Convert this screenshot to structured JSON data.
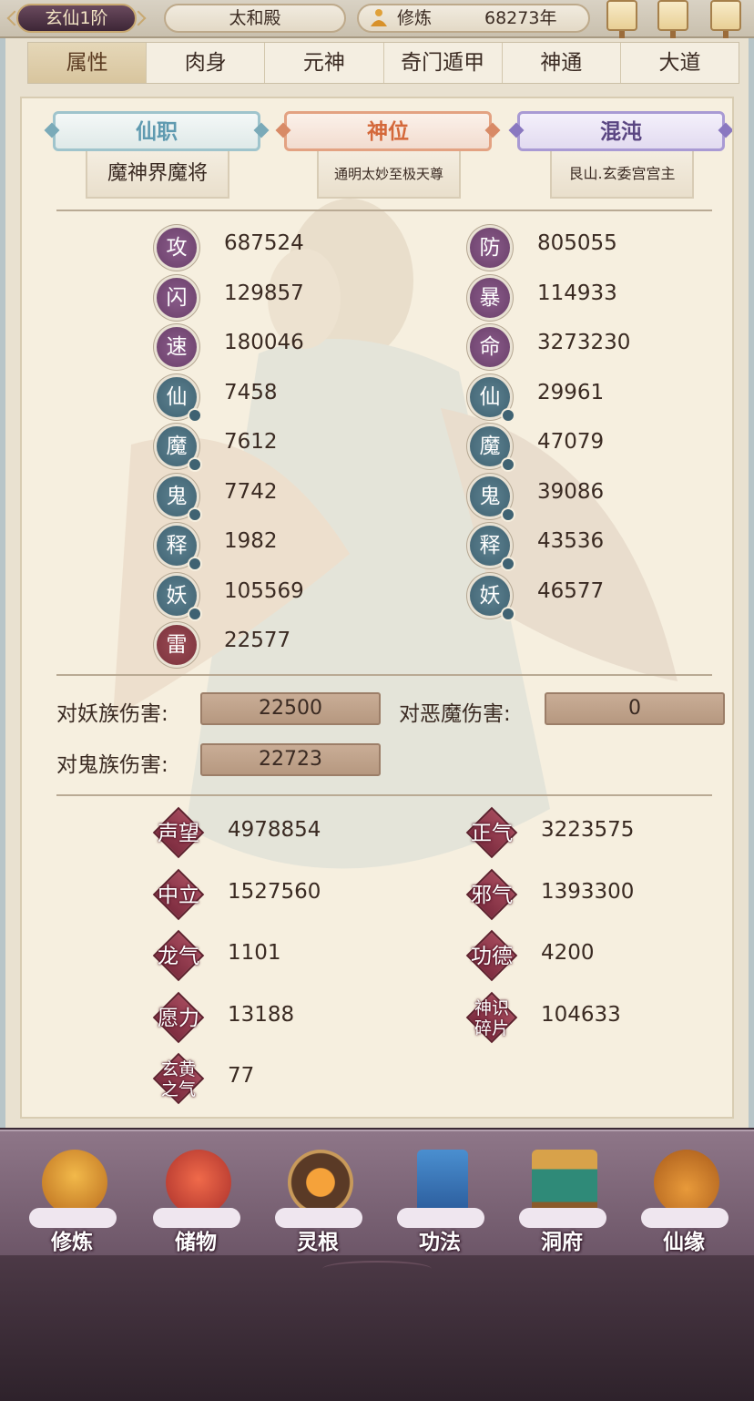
{
  "topbar": {
    "rank": "玄仙1阶",
    "location": "太和殿",
    "cultivation_label": "修炼",
    "cultivation_value": "68273年"
  },
  "tabs": [
    {
      "label": "属性",
      "active": true
    },
    {
      "label": "肉身",
      "active": false
    },
    {
      "label": "元神",
      "active": false
    },
    {
      "label": "奇门遁甲",
      "active": false
    },
    {
      "label": "神通",
      "active": false
    },
    {
      "label": "大道",
      "active": false
    }
  ],
  "titles": {
    "xianzhi": {
      "title": "仙职",
      "value": "魔神界魔将"
    },
    "shenwei": {
      "title": "神位",
      "value": "通明太妙至极天尊"
    },
    "hundun": {
      "title": "混沌",
      "value": "艮山.玄委宫宫主"
    }
  },
  "stats_left": [
    {
      "glyph": "攻",
      "value": "687524",
      "color": "purple"
    },
    {
      "glyph": "闪",
      "value": "129857",
      "color": "purple"
    },
    {
      "glyph": "速",
      "value": "180046",
      "color": "purple"
    },
    {
      "glyph": "仙",
      "value": "7458",
      "color": "teal"
    },
    {
      "glyph": "魔",
      "value": "7612",
      "color": "teal"
    },
    {
      "glyph": "鬼",
      "value": "7742",
      "color": "teal"
    },
    {
      "glyph": "释",
      "value": "1982",
      "color": "teal"
    },
    {
      "glyph": "妖",
      "value": "105569",
      "color": "teal"
    },
    {
      "glyph": "雷",
      "value": "22577",
      "color": "red"
    }
  ],
  "stats_right": [
    {
      "glyph": "防",
      "value": "805055",
      "color": "purple"
    },
    {
      "glyph": "暴",
      "value": "114933",
      "color": "purple"
    },
    {
      "glyph": "命",
      "value": "3273230",
      "color": "purple"
    },
    {
      "glyph": "仙",
      "value": "29961",
      "color": "teal"
    },
    {
      "glyph": "魔",
      "value": "47079",
      "color": "teal"
    },
    {
      "glyph": "鬼",
      "value": "39086",
      "color": "teal"
    },
    {
      "glyph": "释",
      "value": "43536",
      "color": "teal"
    },
    {
      "glyph": "妖",
      "value": "46577",
      "color": "teal"
    }
  ],
  "damage": {
    "yao_label": "对妖族伤害:",
    "yao_value": "22500",
    "emo_label": "对恶魔伤害:",
    "emo_value": "0",
    "gui_label": "对鬼族伤害:",
    "gui_value": "22723"
  },
  "reputation_left": [
    {
      "label": "声望",
      "value": "4978854"
    },
    {
      "label": "中立",
      "value": "1527560"
    },
    {
      "label": "龙气",
      "value": "1101"
    },
    {
      "label": "愿力",
      "value": "13188"
    },
    {
      "label": "玄黄之气",
      "value": "77"
    }
  ],
  "reputation_right": [
    {
      "label": "正气",
      "value": "3223575"
    },
    {
      "label": "邪气",
      "value": "1393300"
    },
    {
      "label": "功德",
      "value": "4200"
    },
    {
      "label": "神识碎片",
      "value": "104633"
    }
  ],
  "bottom_nav": [
    {
      "label": "修炼",
      "icon": "monk-icon"
    },
    {
      "label": "储物",
      "icon": "bag-icon"
    },
    {
      "label": "灵根",
      "icon": "spirit-root-icon"
    },
    {
      "label": "功法",
      "icon": "book-icon"
    },
    {
      "label": "洞府",
      "icon": "cave-house-icon"
    },
    {
      "label": "仙缘",
      "icon": "gourd-icon"
    }
  ],
  "colors": {
    "seal_purple": "#6a3f6a",
    "seal_teal": "#3f6272",
    "seal_red": "#7a323c",
    "reputation_diamond": "#8e3448",
    "nav_bg": "#7d6778"
  }
}
